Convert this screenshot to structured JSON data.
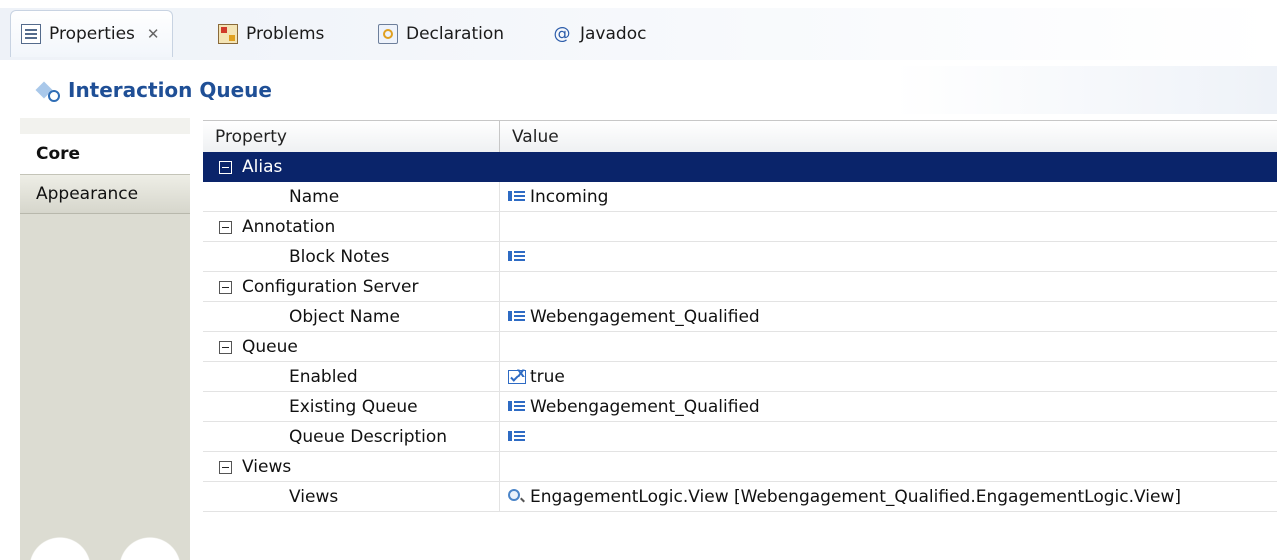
{
  "tabs": [
    {
      "label": "Properties",
      "icon": "properties-icon",
      "active": true,
      "close": "✕"
    },
    {
      "label": "Problems",
      "icon": "problems-icon"
    },
    {
      "label": "Declaration",
      "icon": "declaration-icon"
    },
    {
      "label": "Javadoc",
      "icon": "at-icon",
      "glyph": "@"
    }
  ],
  "header": {
    "title": "Interaction Queue",
    "icon": "interaction-queue-icon"
  },
  "sections": [
    {
      "label": "Core",
      "active": true
    },
    {
      "label": "Appearance",
      "active": false
    }
  ],
  "table": {
    "columns": {
      "property": "Property",
      "value": "Value"
    },
    "rows": [
      {
        "type": "group",
        "label": "Alias",
        "selected": true
      },
      {
        "type": "prop",
        "label": "Name",
        "value": "Incoming",
        "value_icon": "text-value-icon"
      },
      {
        "type": "group",
        "label": "Annotation"
      },
      {
        "type": "prop",
        "label": "Block Notes",
        "value": "",
        "value_icon": "text-value-icon"
      },
      {
        "type": "group",
        "label": "Configuration Server"
      },
      {
        "type": "prop",
        "label": "Object Name",
        "value": "Webengagement_Qualified",
        "value_icon": "text-value-icon"
      },
      {
        "type": "group",
        "label": "Queue"
      },
      {
        "type": "prop",
        "label": "Enabled",
        "value": "true",
        "value_icon": "boolean-value-icon"
      },
      {
        "type": "prop",
        "label": "Existing Queue",
        "value": "Webengagement_Qualified",
        "value_icon": "text-value-icon"
      },
      {
        "type": "prop",
        "label": "Queue Description",
        "value": "",
        "value_icon": "text-value-icon"
      },
      {
        "type": "group",
        "label": "Views"
      },
      {
        "type": "prop",
        "label": "Views",
        "value": "EngagementLogic.View [Webengagement_Qualified.EngagementLogic.View]",
        "value_icon": "view-value-icon"
      }
    ]
  },
  "colors": {
    "selection": "#0a246a",
    "title": "#1f4f96"
  }
}
